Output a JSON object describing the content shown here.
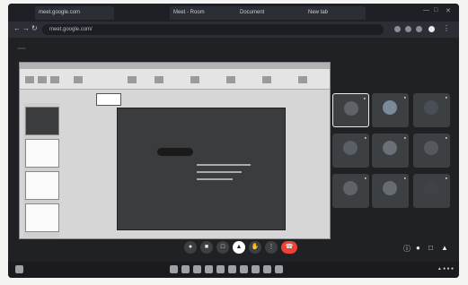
{
  "browser": {
    "tabs": [
      {
        "label": "meet.google.com"
      },
      {
        "label": "Meet - Room"
      },
      {
        "label": "Document"
      },
      {
        "label": "New tab"
      }
    ],
    "url": "meet.google.com/"
  },
  "meet": {
    "presenting_chip": "",
    "presenting_text": "",
    "participants": [
      {
        "name": "",
        "avatar_color": "#5f6368"
      },
      {
        "name": "",
        "avatar_color": "#7b8a99"
      },
      {
        "name": "",
        "avatar_color": "#4a4f57"
      },
      {
        "name": "",
        "avatar_color": "#5a5e66"
      },
      {
        "name": "",
        "avatar_color": "#6b6f76"
      },
      {
        "name": "",
        "avatar_color": "#55595f"
      },
      {
        "name": "",
        "avatar_color": "#5f6368"
      },
      {
        "name": "",
        "avatar_color": "#676b72"
      },
      {
        "name": "",
        "avatar_color": "#3f4349"
      }
    ],
    "time_label": "",
    "controls": {
      "mic_icon": "mic-icon",
      "camera_icon": "camera-icon",
      "present_icon": "present-icon",
      "end_icon": "end-call-icon"
    }
  },
  "accent_colors": {
    "end_call": "#ea4335",
    "background": "#202124"
  }
}
